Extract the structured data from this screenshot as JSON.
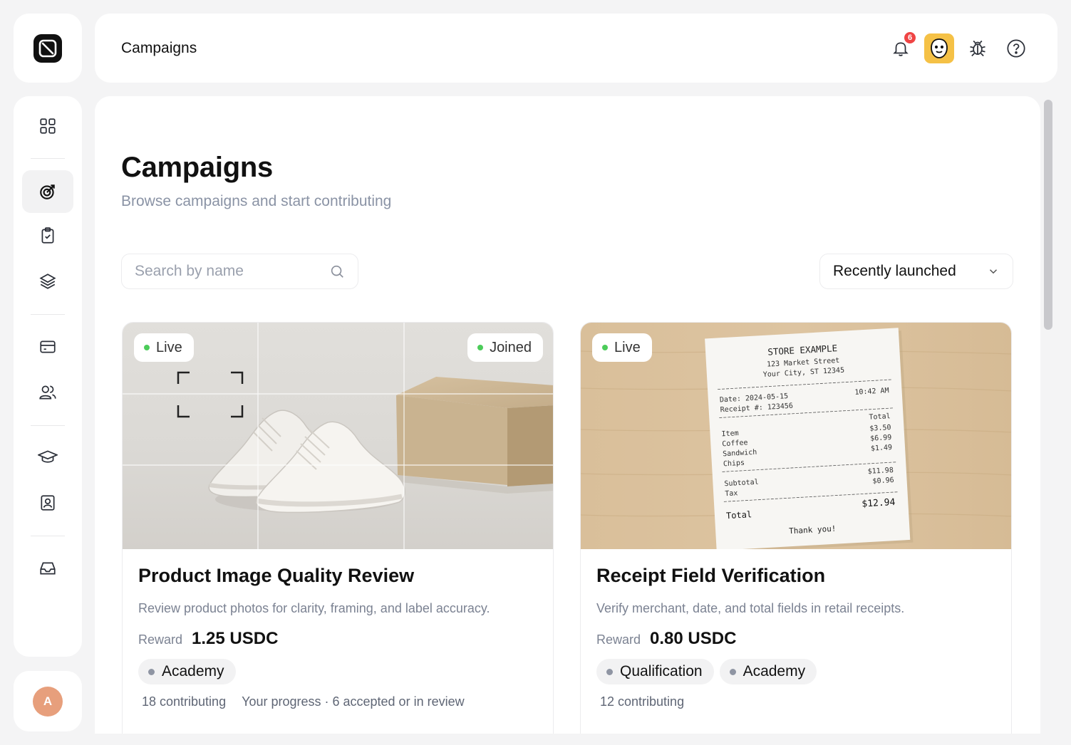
{
  "topbar": {
    "title": "Campaigns",
    "notification_count": "6"
  },
  "user": {
    "avatar_initial": "A"
  },
  "page": {
    "title": "Campaigns",
    "subtitle": "Browse campaigns and start contributing"
  },
  "search": {
    "placeholder": "Search by name",
    "value": ""
  },
  "sort": {
    "selected": "Recently launched"
  },
  "campaigns": [
    {
      "status": "Live",
      "joined_label": "Joined",
      "title": "Product Image Quality Review",
      "description": "Review product photos for clarity, framing, and label accuracy.",
      "reward_label": "Reward",
      "reward": "1.25 USDC",
      "tags": [
        "Academy"
      ],
      "contributing": "18 contributing",
      "progress": "Your progress · 6 accepted or in review"
    },
    {
      "status": "Live",
      "title": "Receipt Field Verification",
      "description": "Verify merchant, date, and total fields in retail receipts.",
      "reward_label": "Reward",
      "reward": "0.80 USDC",
      "tags": [
        "Qualification",
        "Academy"
      ],
      "contributing": "12 contributing",
      "receipt": {
        "store": "STORE EXAMPLE",
        "address1": "123 Market Street",
        "address2": "Your City, ST 12345",
        "date": "Date: 2024-05-15",
        "time": "10:42 AM",
        "receipt_no": "Receipt #: 123456",
        "col_item": "Item",
        "col_total": "Total",
        "items": [
          {
            "name": "Coffee",
            "price": "$3.50"
          },
          {
            "name": "Sandwich",
            "price": "$6.99"
          },
          {
            "name": "Chips",
            "price": "$1.49"
          }
        ],
        "subtotal_label": "Subtotal",
        "subtotal": "$11.98",
        "tax_label": "Tax",
        "tax": "$0.96",
        "total_label": "Total",
        "total": "$12.94",
        "thanks": "Thank you!"
      }
    }
  ],
  "colors": {
    "accent_live": "#4ccc5a",
    "badge": "#ef4444",
    "avatar": "#e79f7c",
    "mascot": "#f5c146"
  }
}
